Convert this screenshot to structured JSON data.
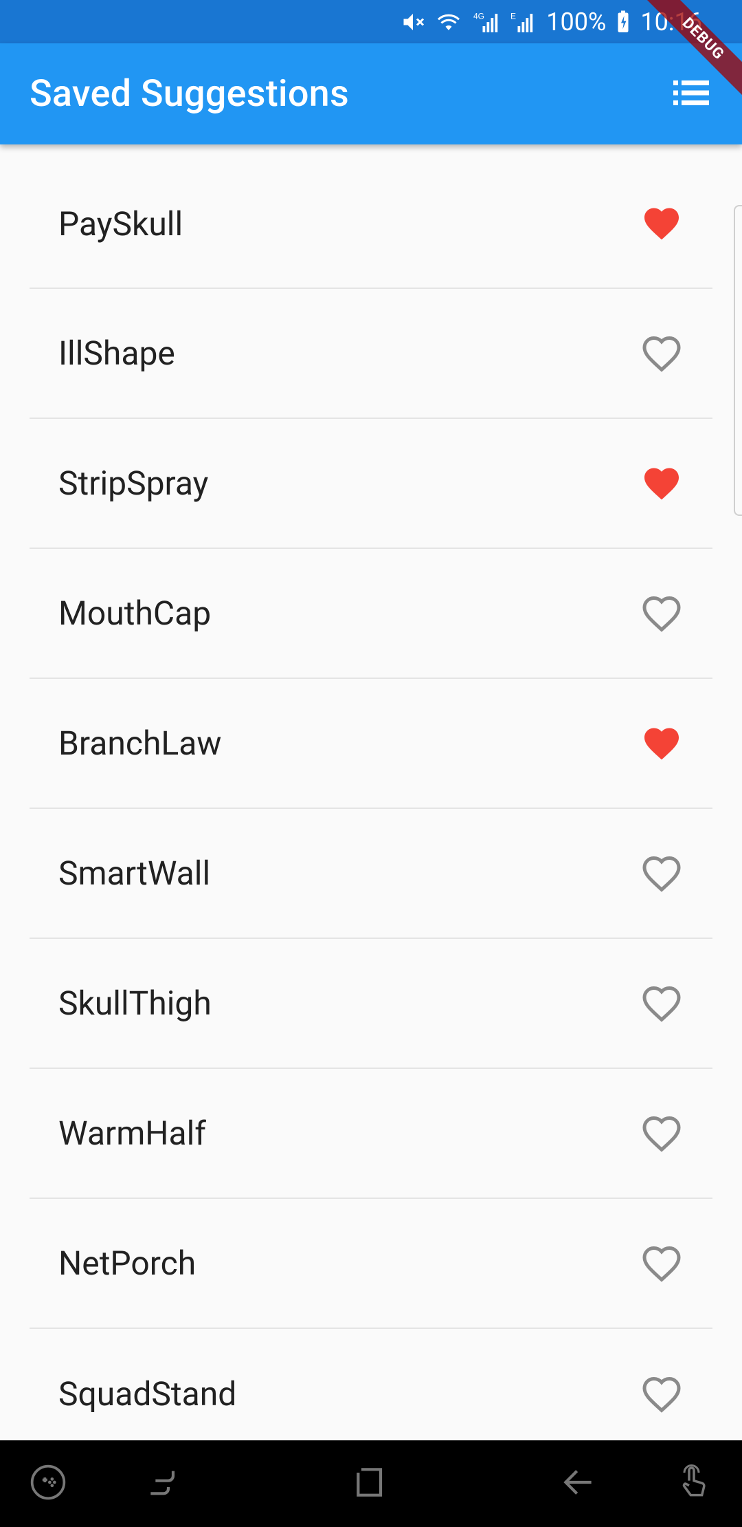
{
  "status_bar": {
    "battery_percent": "100%",
    "time": "10:16",
    "icons": [
      "mute-icon",
      "wifi-icon",
      "signal-4g-icon",
      "signal-e-icon",
      "battery-charging-icon"
    ]
  },
  "debug_banner": "DEBUG",
  "app_bar": {
    "title": "Saved Suggestions",
    "action_icon": "list-icon"
  },
  "suggestions": [
    {
      "name": "PaySkull",
      "favorited": true
    },
    {
      "name": "IllShape",
      "favorited": false
    },
    {
      "name": "StripSpray",
      "favorited": true
    },
    {
      "name": "MouthCap",
      "favorited": false
    },
    {
      "name": "BranchLaw",
      "favorited": true
    },
    {
      "name": "SmartWall",
      "favorited": false
    },
    {
      "name": "SkullThigh",
      "favorited": false
    },
    {
      "name": "WarmHalf",
      "favorited": false
    },
    {
      "name": "NetPorch",
      "favorited": false
    },
    {
      "name": "SquadStand",
      "favorited": false
    }
  ],
  "colors": {
    "status_bar": "#1976d2",
    "app_bar": "#2196f3",
    "heart_filled": "#f44336",
    "heart_outline": "#8a8a8a",
    "text": "#212121",
    "divider": "#e4e4e4"
  },
  "nav_bar": {
    "items": [
      "game-launcher-icon",
      "recent-apps-icon",
      "home-icon",
      "back-icon",
      "touch-icon"
    ]
  }
}
